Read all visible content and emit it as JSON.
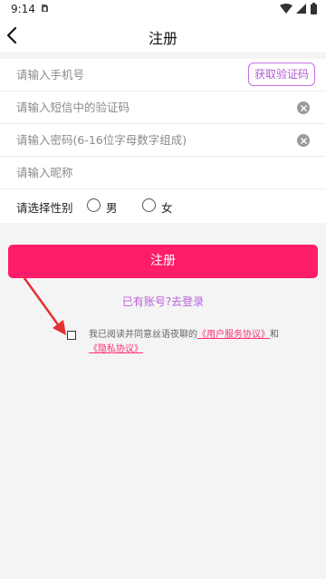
{
  "status_bar": {
    "time": "9:14"
  },
  "header": {
    "title": "注册"
  },
  "form": {
    "phone_placeholder": "请输入手机号",
    "get_code_label": "获取验证码",
    "sms_code_placeholder": "请输入短信中的验证码",
    "password_placeholder": "请输入密码(6-16位字母数字组成)",
    "nickname_placeholder": "请输入昵称",
    "gender_label": "请选择性别",
    "gender_options": [
      "男",
      "女"
    ]
  },
  "register_button": "注册",
  "login_link": "已有账号?去登录",
  "agreement": {
    "prefix": "我已阅读并同意丝语夜聊的",
    "terms_link": "《用户服务协议》",
    "and": "和",
    "privacy_link": "《隐私协议》"
  },
  "colors": {
    "accent": "#fe1d6a",
    "purple": "#b85fdc",
    "annotation_arrow": "#e53030"
  }
}
